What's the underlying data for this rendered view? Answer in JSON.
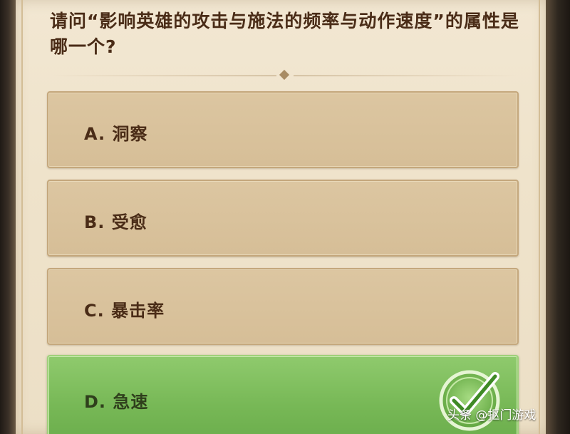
{
  "question": {
    "text": "请问“影响英雄的攻击与施法的频率与动作速度”的属性是哪一个?"
  },
  "options": [
    {
      "label": "A. 洞察",
      "state": "normal"
    },
    {
      "label": "B. 受愈",
      "state": "normal"
    },
    {
      "label": "C. 暴击率",
      "state": "normal"
    },
    {
      "label": "D. 急速",
      "state": "correct"
    }
  ],
  "icons": {
    "correct": "checkmark-icon"
  },
  "watermark": {
    "text": "头条 @抠门游戏"
  },
  "colors": {
    "question_text": "#4a2c17",
    "option_bg": "#d9c39d",
    "correct_bg": "#7fbe5c",
    "panel_bg": "#efe3cb"
  }
}
